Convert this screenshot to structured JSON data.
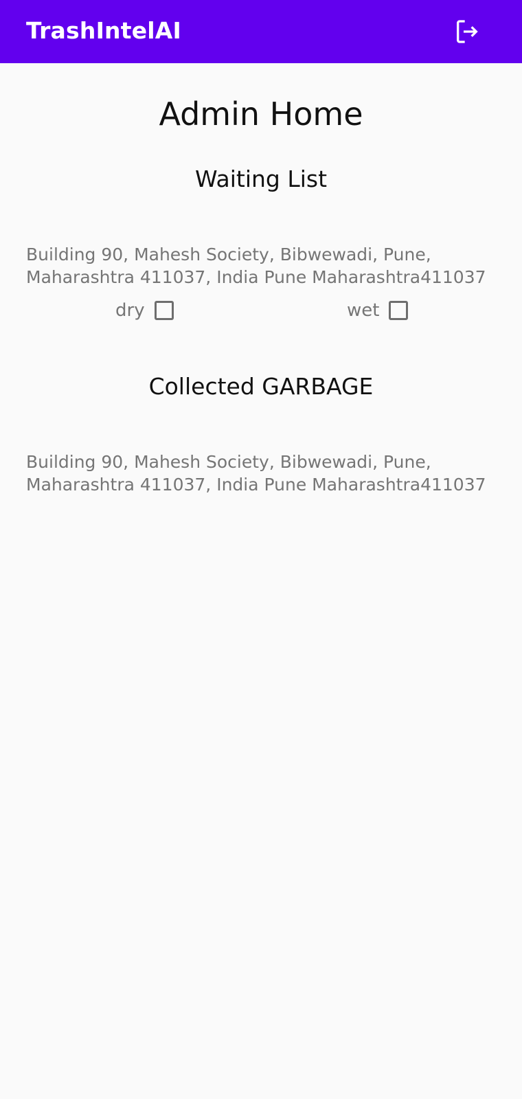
{
  "app_bar": {
    "title": "TrashIntelAI",
    "logout_icon": "logout-icon",
    "background": "#6200EE"
  },
  "page": {
    "title": "Admin Home"
  },
  "waiting_list": {
    "heading": "Waiting List",
    "items": [
      {
        "address": "Building 90, Mahesh Society, Bibwewadi, Pune,\nMaharashtra 411037, India  Pune Maharashtra411037",
        "dry_label": "dry",
        "dry_checked": false,
        "wet_label": "wet",
        "wet_checked": false
      }
    ]
  },
  "collected": {
    "heading": "Collected GARBAGE",
    "items": [
      {
        "address": "Building 90, Mahesh Society, Bibwewadi, Pune,\nMaharashtra 411037, India  Pune Maharashtra411037"
      }
    ]
  }
}
